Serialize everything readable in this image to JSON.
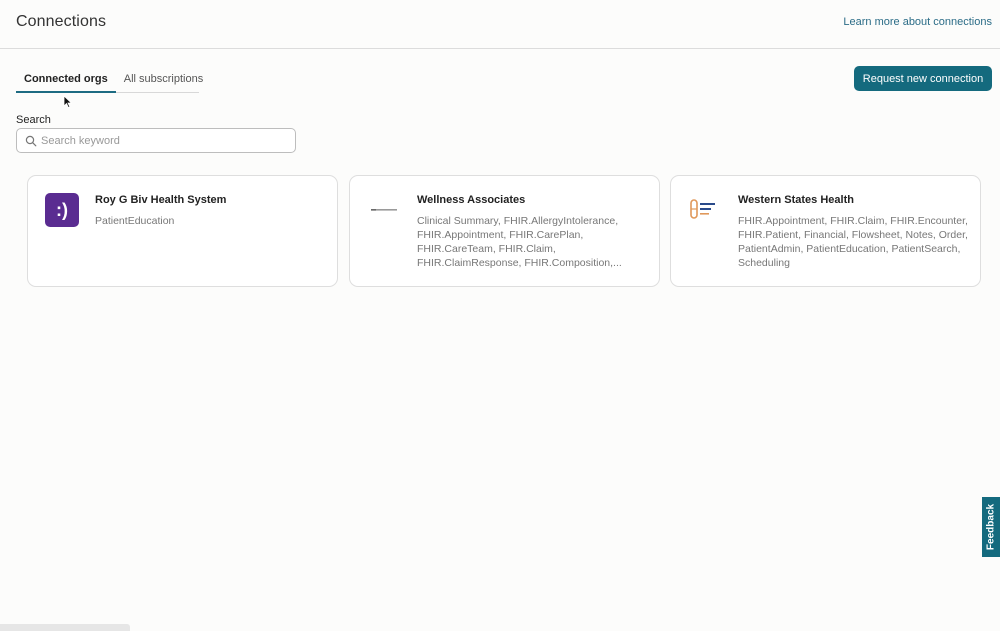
{
  "header": {
    "title": "Connections",
    "learn_link": "Learn more about connections"
  },
  "tabs": [
    {
      "label": "Connected orgs",
      "active": true
    },
    {
      "label": "All subscriptions",
      "active": false
    }
  ],
  "actions": {
    "request_label": "Request new connection"
  },
  "search": {
    "label": "Search",
    "placeholder": "Search keyword",
    "value": ""
  },
  "cards": [
    {
      "name": "Roy G Biv Health System",
      "description": "PatientEducation",
      "logo_text": ":)",
      "logo_color": "#5a2c91"
    },
    {
      "name": "Wellness Associates",
      "description": "Clinical Summary, FHIR.AllergyIntolerance, FHIR.Appointment, FHIR.CarePlan, FHIR.CareTeam, FHIR.Claim, FHIR.ClaimResponse, FHIR.Composition,..."
    },
    {
      "name": "Western States Health",
      "description": "FHIR.Appointment, FHIR.Claim, FHIR.Encounter, FHIR.Patient, Financial, Flowsheet, Notes, Order, PatientAdmin, PatientEducation, PatientSearch, Scheduling",
      "logo_accent": "#e0985a"
    }
  ],
  "feedback": {
    "label": "Feedback"
  },
  "colors": {
    "primary": "#146a7e",
    "link": "#2b6c87"
  }
}
